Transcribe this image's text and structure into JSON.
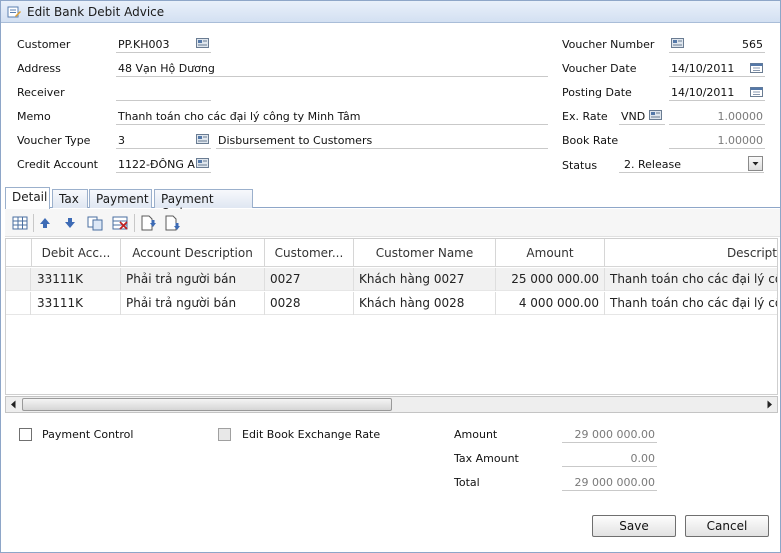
{
  "window": {
    "title": "Edit Bank Debit Advice"
  },
  "form": {
    "customer": {
      "label": "Customer",
      "value": "PP.KH003"
    },
    "address": {
      "label": "Address",
      "value": "48 Vạn Hộ Dương"
    },
    "receiver": {
      "label": "Receiver",
      "value": ""
    },
    "memo": {
      "label": "Memo",
      "value": "Thanh toán cho các đại lý công ty Minh Tâm"
    },
    "voucher_type": {
      "label": "Voucher Type",
      "value": "3",
      "description": "Disbursement to Customers"
    },
    "credit_account": {
      "label": "Credit Account",
      "value": "1122-ĐÔNG A"
    },
    "voucher_number": {
      "label": "Voucher Number",
      "value": "565"
    },
    "voucher_date": {
      "label": "Voucher Date",
      "value": "14/10/2011"
    },
    "posting_date": {
      "label": "Posting Date",
      "value": "14/10/2011"
    },
    "ex_rate": {
      "label": "Ex. Rate",
      "currency": "VND",
      "value": "1.00000"
    },
    "book_rate": {
      "label": "Book Rate",
      "value": "1.00000"
    },
    "status": {
      "label": "Status",
      "value": "2. Release"
    }
  },
  "tabs": [
    {
      "label": "Detail"
    },
    {
      "label": "Tax"
    },
    {
      "label": "Payment"
    },
    {
      "label": "Payment Order"
    }
  ],
  "toolbar_icons": [
    "grid-add-icon",
    "move-up-icon",
    "move-down-icon",
    "copy-rows-icon",
    "delete-rows-icon",
    "insert-above-icon",
    "insert-below-icon"
  ],
  "grid": {
    "columns": [
      "Debit Acc...",
      "Account Description",
      "Customer...",
      "Customer Name",
      "Amount",
      "Descript"
    ],
    "rows": [
      [
        "33111K",
        "Phải trả người bán",
        "0027",
        "Khách hàng 0027",
        "25 000 000.00",
        "Thanh toán cho các đại lý côn"
      ],
      [
        "33111K",
        "Phải trả người bán",
        "0028",
        "Khách hàng 0028",
        "4 000 000.00",
        "Thanh toán cho các đại lý côn"
      ]
    ]
  },
  "footer": {
    "payment_control": {
      "label": "Payment Control",
      "checked": false
    },
    "edit_book_exchange_rate": {
      "label": "Edit Book Exchange Rate",
      "checked": false
    },
    "amount": {
      "label": "Amount",
      "value": "29 000 000.00"
    },
    "tax_amount": {
      "label": "Tax Amount",
      "value": "0.00"
    },
    "total": {
      "label": "Total",
      "value": "29 000 000.00"
    }
  },
  "buttons": {
    "save": "Save",
    "cancel": "Cancel"
  },
  "colors": {
    "title_bar": "#d3e0f2",
    "border": "#8ea6c8"
  }
}
